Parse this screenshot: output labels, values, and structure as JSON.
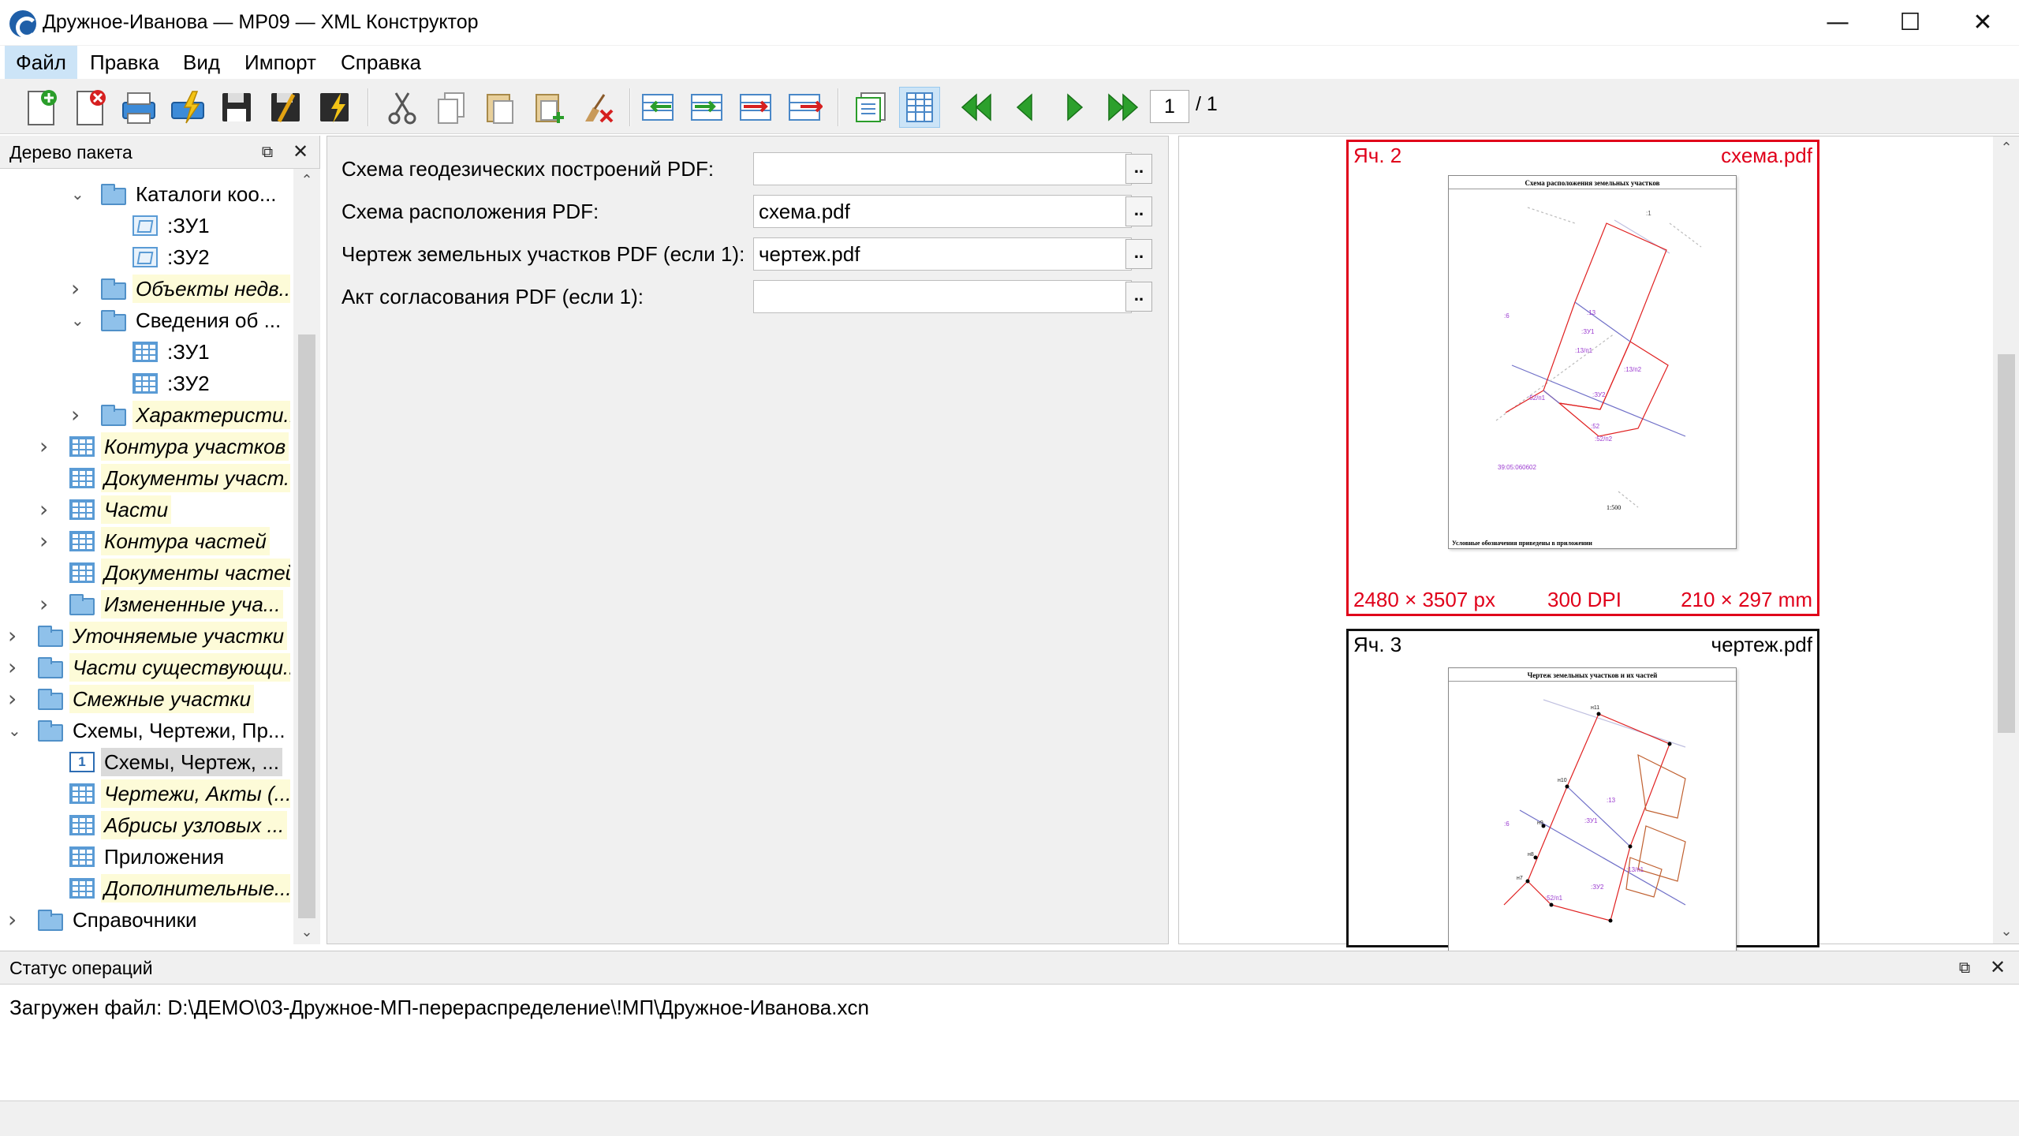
{
  "window": {
    "title": "Дружное-Иванова — МР09 — XML Конструктор",
    "minimize": "—",
    "maximize": "☐",
    "close": "✕"
  },
  "menu": [
    "Файл",
    "Правка",
    "Вид",
    "Импорт",
    "Справка"
  ],
  "toolbar": {
    "icons": [
      "new-document-icon",
      "delete-document-icon",
      "print-icon",
      "validate-icon",
      "save-icon",
      "save-as-icon",
      "sign-icon",
      "cut-icon",
      "copy-icon",
      "paste-icon",
      "paste-special-icon",
      "clear-icon",
      "insert-before-icon",
      "insert-after-icon",
      "move-down-icon",
      "move-up-icon",
      "preview-icon",
      "table-view-icon",
      "first-page-icon",
      "prev-page-icon",
      "next-page-icon",
      "last-page-icon"
    ],
    "page_current": "1",
    "page_total": "/ 1"
  },
  "tree": {
    "title": "Дерево пакета",
    "items": [
      {
        "label": "Каталоги коо...",
        "icon": "folder",
        "level": 2,
        "arrow": "expanded",
        "hl": false
      },
      {
        "label": ":ЗУ1",
        "icon": "map",
        "level": 3,
        "arrow": "none",
        "hl": false
      },
      {
        "label": ":ЗУ2",
        "icon": "map",
        "level": 3,
        "arrow": "none",
        "hl": false
      },
      {
        "label": "Объекты недв...",
        "icon": "folder",
        "level": 2,
        "arrow": "collapsed",
        "hl": true
      },
      {
        "label": "Сведения об ...",
        "icon": "folder",
        "level": 2,
        "arrow": "expanded",
        "hl": false
      },
      {
        "label": ":ЗУ1",
        "icon": "table",
        "level": 3,
        "arrow": "none",
        "hl": false
      },
      {
        "label": ":ЗУ2",
        "icon": "table",
        "level": 3,
        "arrow": "none",
        "hl": false
      },
      {
        "label": "Характеристи...",
        "icon": "folder",
        "level": 2,
        "arrow": "collapsed",
        "hl": true
      },
      {
        "label": "Контура участков",
        "icon": "table",
        "level": 1,
        "arrow": "collapsed",
        "hl": true
      },
      {
        "label": "Документы участ...",
        "icon": "table",
        "level": 1,
        "arrow": "none",
        "hl": true
      },
      {
        "label": "Части",
        "icon": "table",
        "level": 1,
        "arrow": "collapsed",
        "hl": true
      },
      {
        "label": "Контура частей",
        "icon": "table",
        "level": 1,
        "arrow": "collapsed",
        "hl": true
      },
      {
        "label": "Документы частей",
        "icon": "table",
        "level": 1,
        "arrow": "none",
        "hl": true
      },
      {
        "label": "Измененные уча...",
        "icon": "folder",
        "level": 1,
        "arrow": "collapsed",
        "hl": true
      },
      {
        "label": "Уточняемые участки",
        "icon": "folder",
        "level": 0,
        "arrow": "collapsed",
        "hl": true
      },
      {
        "label": "Части существующи...",
        "icon": "folder",
        "level": 0,
        "arrow": "collapsed",
        "hl": true
      },
      {
        "label": "Смежные участки",
        "icon": "folder",
        "level": 0,
        "arrow": "collapsed",
        "hl": true
      },
      {
        "label": "Схемы, Чертежи, Пр...",
        "icon": "folder",
        "level": 0,
        "arrow": "expanded",
        "hl": false
      },
      {
        "label": "Схемы, Чертеж, ...",
        "icon": "num",
        "level": 1,
        "arrow": "none",
        "hl": false,
        "sel": true
      },
      {
        "label": "Чертежи, Акты (...",
        "icon": "table",
        "level": 1,
        "arrow": "none",
        "hl": true
      },
      {
        "label": "Абрисы узловых ...",
        "icon": "table",
        "level": 1,
        "arrow": "none",
        "hl": true
      },
      {
        "label": "Приложения",
        "icon": "table",
        "level": 1,
        "arrow": "none",
        "hl": false
      },
      {
        "label": "Дополнительные...",
        "icon": "table",
        "level": 1,
        "arrow": "none",
        "hl": true
      },
      {
        "label": "Справочники",
        "icon": "folder",
        "level": 0,
        "arrow": "collapsed",
        "hl": false
      }
    ]
  },
  "form": {
    "fields": [
      {
        "label": "Схема геодезических построений PDF:",
        "value": ""
      },
      {
        "label": "Схема расположения PDF:",
        "value": "схема.pdf"
      },
      {
        "label": "Чертеж земельных участков PDF (если 1):",
        "value": "чертеж.pdf"
      },
      {
        "label": "Акт согласования PDF (если 1):",
        "value": ""
      }
    ],
    "browse_label": ".."
  },
  "preview": {
    "card1": {
      "cell": "Яч. 2",
      "file": "схема.pdf",
      "size_px": "2480 × 3507 px",
      "dpi": "300 DPI",
      "size_mm": "210 × 297 mm",
      "doc_title": "Схема расположения земельных участков",
      "doc_foot": "Условные обозначения приведены в приложении",
      "doc_scale": "1:500",
      "doc_labels": [
        ":ЗУ1",
        ":ЗУ2",
        ":13",
        ":13/п1",
        ":13/п2",
        ":52/п1",
        ":52/п2",
        ":52",
        ":6",
        ":1",
        "39:05:060602"
      ]
    },
    "card2": {
      "cell": "Яч. 3",
      "file": "чертеж.pdf",
      "doc_title": "Чертеж земельных участков и их частей",
      "doc_labels": [
        ":ЗУ1",
        ":ЗУ2",
        ":13",
        ":13/п1",
        ":52/п1",
        ":6",
        "н11",
        "н10",
        "н9",
        "н8",
        "н7"
      ]
    }
  },
  "status": {
    "title": "Статус операций",
    "message": "Загружен файл: D:\\ДЕМО\\03-Дружное-МП-перераспределение\\!МП\\Дружное-Иванова.xcn"
  }
}
